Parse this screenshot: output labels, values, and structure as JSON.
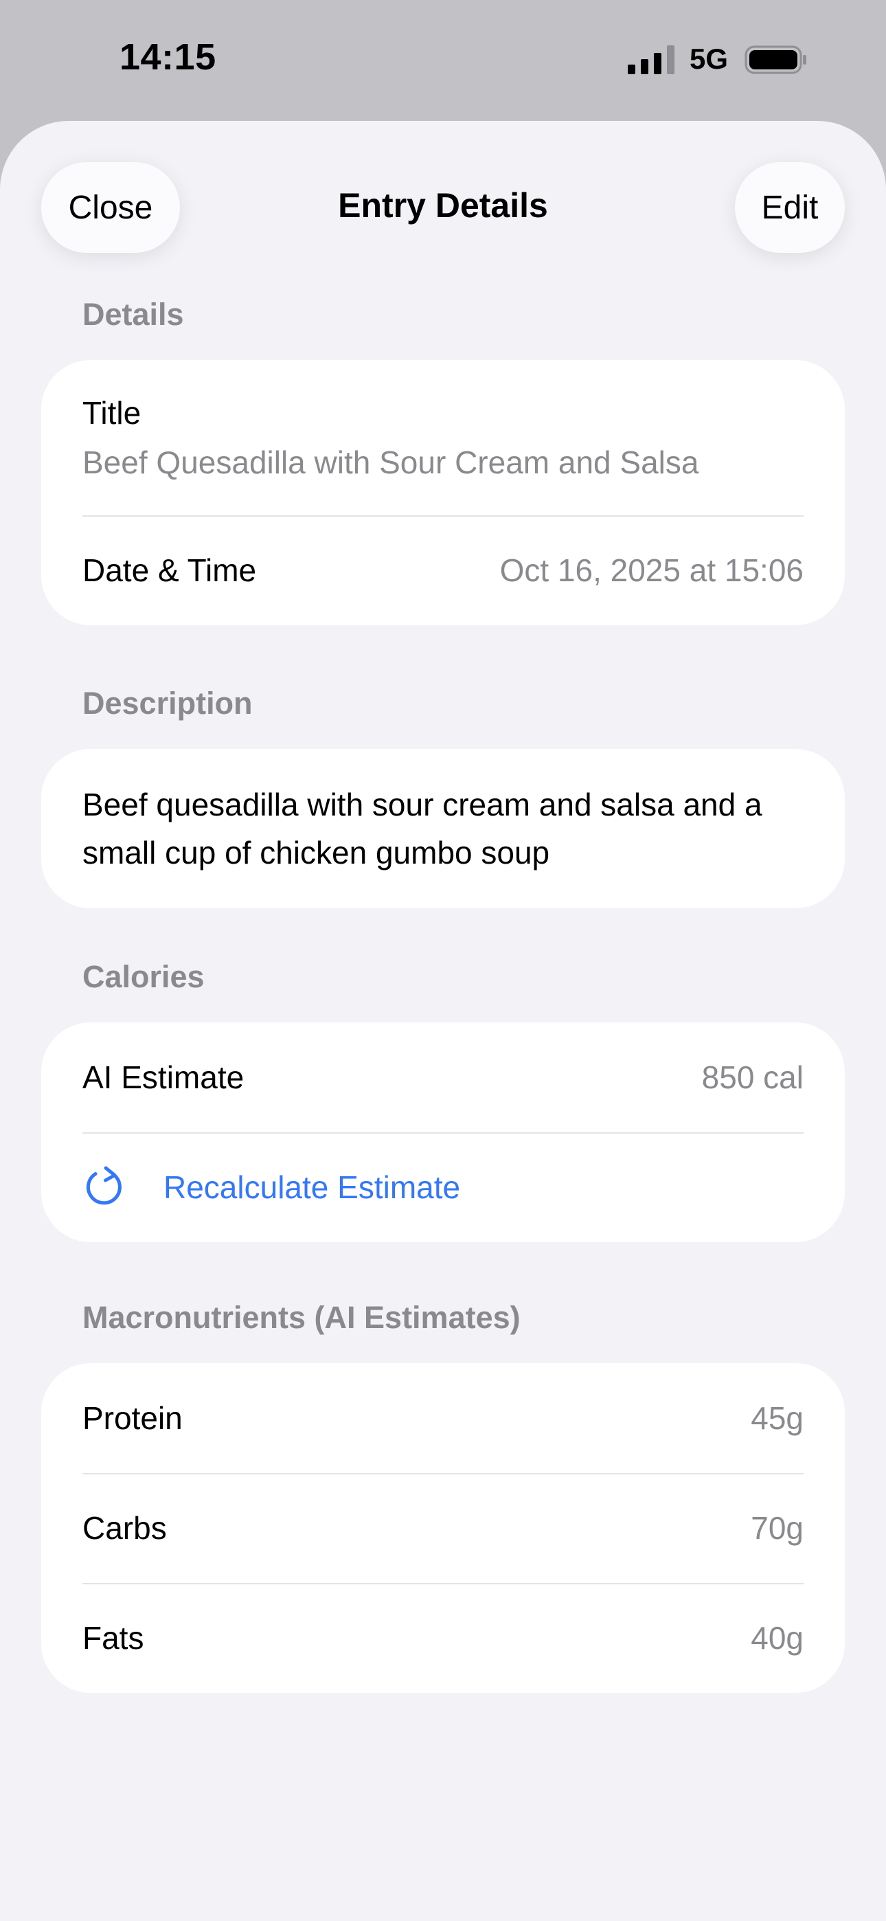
{
  "status_bar": {
    "time": "14:15",
    "network": "5G"
  },
  "nav": {
    "close_label": "Close",
    "title": "Entry Details",
    "edit_label": "Edit"
  },
  "details": {
    "header": "Details",
    "title_label": "Title",
    "title_value": "Beef Quesadilla with Sour Cream and Salsa",
    "datetime_label": "Date & Time",
    "datetime_value": "Oct 16, 2025 at 15:06"
  },
  "description": {
    "header": "Description",
    "text": "Beef quesadilla with sour cream and salsa and a small cup of chicken gumbo soup"
  },
  "calories": {
    "header": "Calories",
    "estimate_label": "AI Estimate",
    "estimate_value": "850 cal",
    "recalc_label": "Recalculate Estimate",
    "recalc_icon": "refresh-icon"
  },
  "macros": {
    "header": "Macronutrients (AI Estimates)",
    "items": [
      {
        "label": "Protein",
        "value": "45g"
      },
      {
        "label": "Carbs",
        "value": "70g"
      },
      {
        "label": "Fats",
        "value": "40g"
      }
    ]
  },
  "colors": {
    "accent": "#3478f6",
    "secondary_text": "#8a8a8e",
    "background": "#f2f2f7",
    "card": "#ffffff"
  }
}
